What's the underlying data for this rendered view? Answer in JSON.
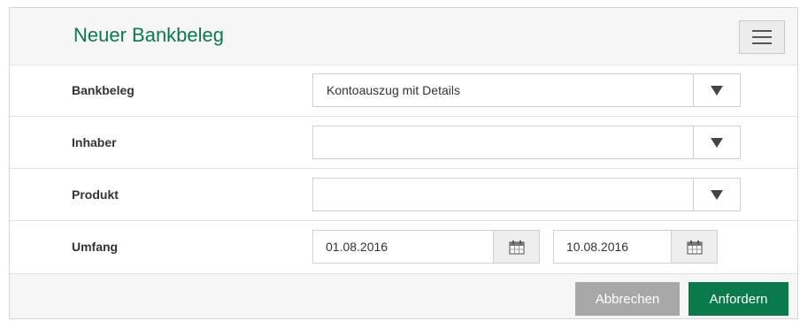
{
  "dialog": {
    "title": "Neuer Bankbeleg",
    "menu_icon": "hamburger-menu-icon"
  },
  "form": {
    "bankbeleg": {
      "label": "Bankbeleg",
      "value": "Kontoauszug mit Details",
      "caret_icon": "caret-down-icon"
    },
    "inhaber": {
      "label": "Inhaber",
      "value": "",
      "caret_icon": "caret-down-icon"
    },
    "produkt": {
      "label": "Produkt",
      "value": "",
      "caret_icon": "caret-down-icon"
    },
    "umfang": {
      "label": "Umfang",
      "from": "01.08.2016",
      "to": "10.08.2016",
      "calendar_icon": "calendar-icon"
    }
  },
  "footer": {
    "cancel_label": "Abbrechen",
    "submit_label": "Anfordern"
  },
  "colors": {
    "accent": "#0b7a4b",
    "cancel": "#a8a8a8"
  }
}
